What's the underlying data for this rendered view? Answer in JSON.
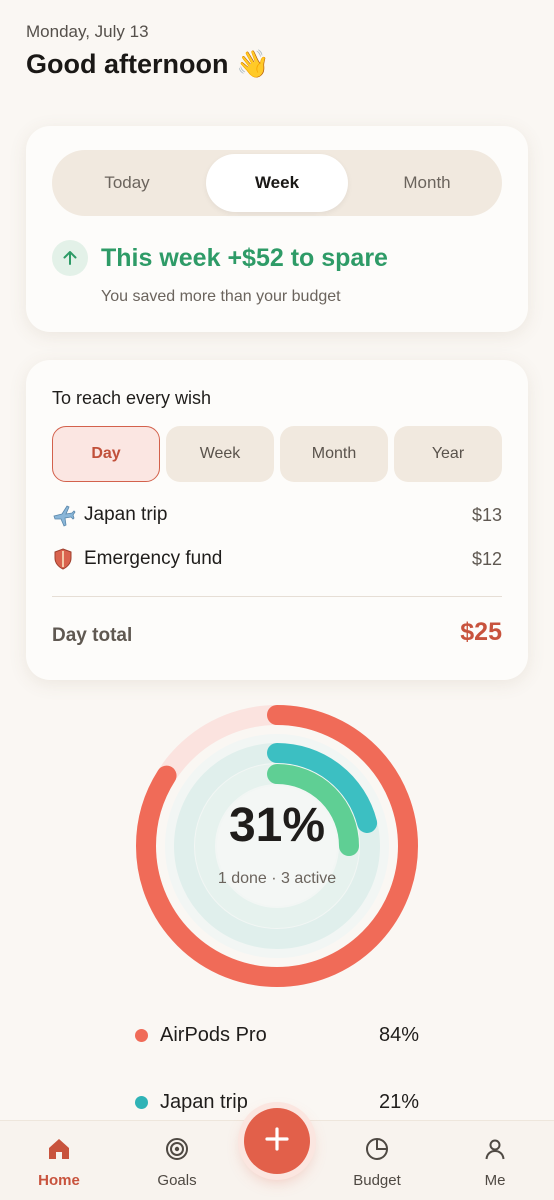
{
  "header": {
    "date": "Monday, July 13",
    "greeting": "Good afternoon 👋"
  },
  "period_switch": {
    "options": [
      "Today",
      "Week",
      "Month"
    ],
    "selected": "Week"
  },
  "summary": {
    "headline": "This week +$52 to spare",
    "subtext": "You saved more than your budget",
    "accent_color": "#2e9b67"
  },
  "wishes": {
    "title": "To reach every wish",
    "chips": [
      "Day",
      "Week",
      "Month",
      "Year"
    ],
    "selected_chip": "Day",
    "items": [
      {
        "icon": "airplane-icon",
        "name": "Japan trip",
        "amount": "$13"
      },
      {
        "icon": "shield-icon",
        "name": "Emergency fund",
        "amount": "$12"
      }
    ],
    "total_label": "Day total",
    "total_value": "$25"
  },
  "progress": {
    "percent_label": "31%",
    "subtitle": "1 done · 3 active",
    "rings": [
      {
        "name": "AirPods Pro",
        "fraction": 0.84,
        "color": "#f06b58"
      },
      {
        "name": "Japan trip",
        "fraction": 0.21,
        "color": "#3cbfc2"
      },
      {
        "name": "goal-3",
        "fraction": 0.25,
        "color": "#5fcf94"
      }
    ],
    "legend": [
      {
        "name": "AirPods Pro",
        "percent": "84%",
        "color": "#f06b58"
      },
      {
        "name": "Japan trip",
        "percent": "21%",
        "color": "#2fb3b6"
      }
    ]
  },
  "tabbar": {
    "items": [
      {
        "label": "Home",
        "icon": "home-icon",
        "active": true
      },
      {
        "label": "Goals",
        "icon": "target-icon",
        "active": false
      },
      {
        "label": "Budget",
        "icon": "pie-chart-icon",
        "active": false
      },
      {
        "label": "Me",
        "icon": "person-icon",
        "active": false
      }
    ],
    "fab_icon": "plus-icon"
  },
  "colors": {
    "background": "#faf7f3",
    "brand": "#e2604a",
    "accent_red": "#c8533d"
  }
}
